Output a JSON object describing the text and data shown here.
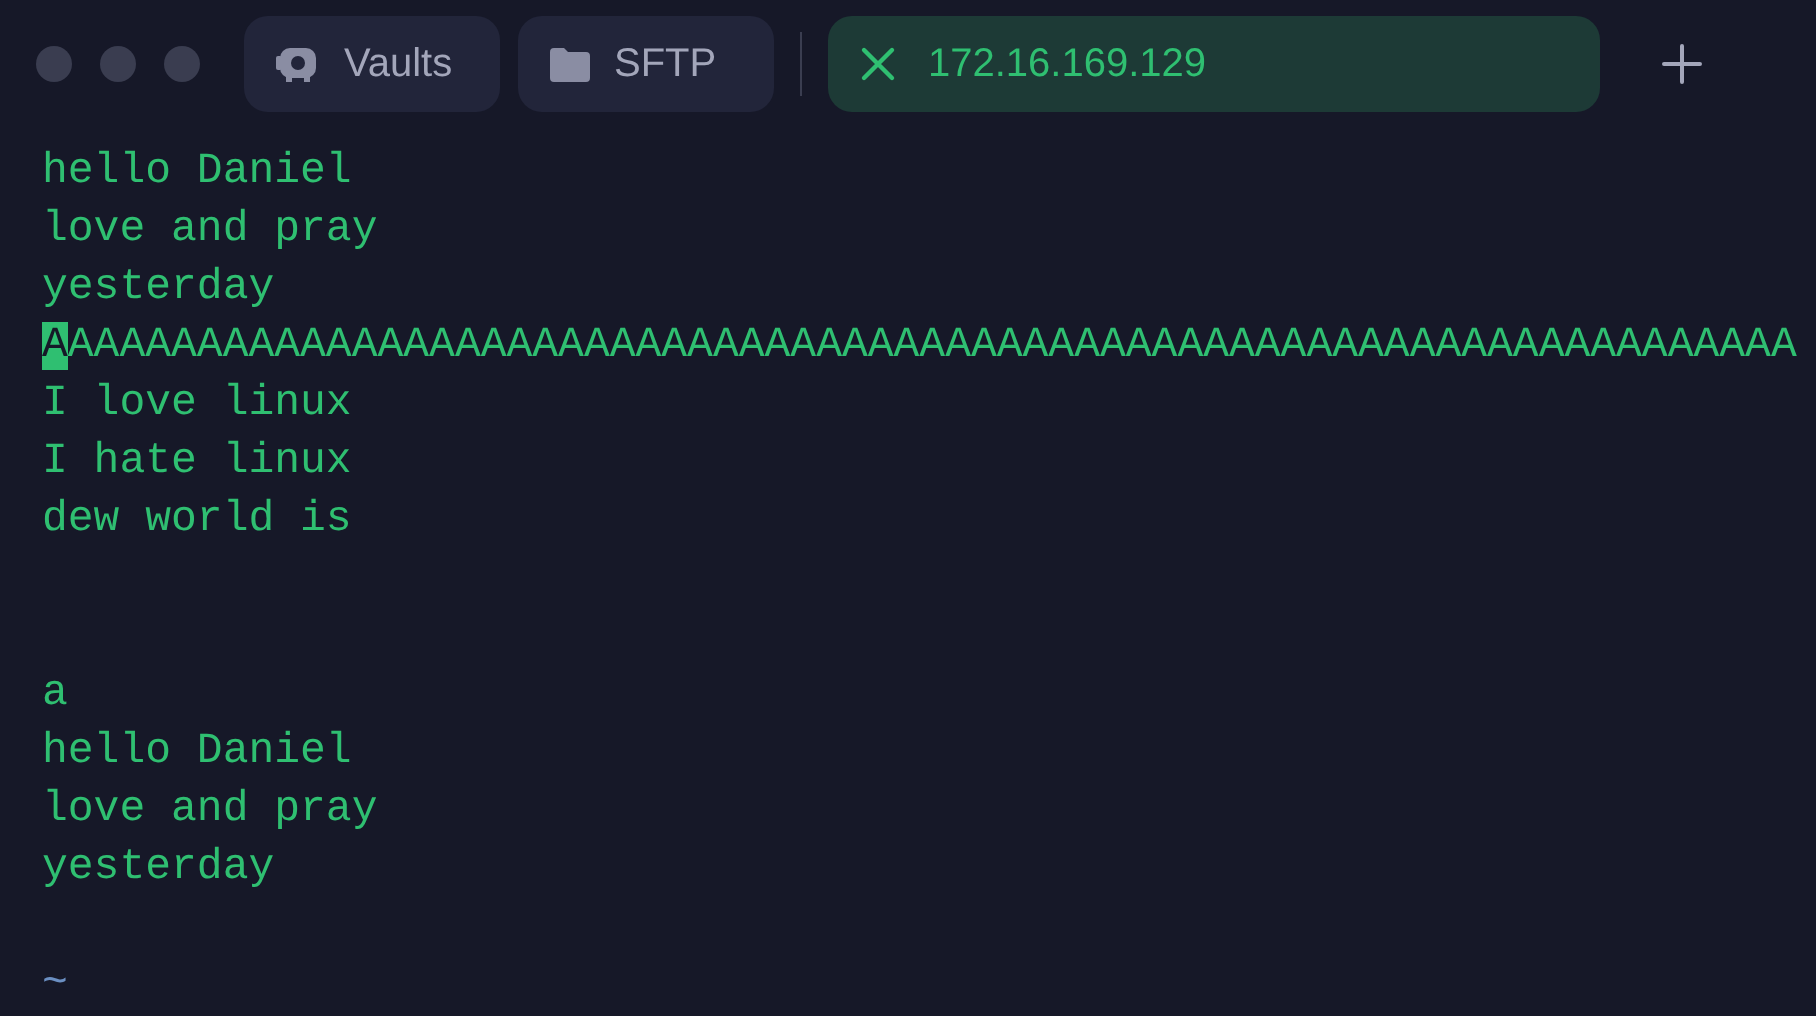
{
  "tabs": [
    {
      "kind": "vaults",
      "label": "Vaults",
      "selected": false
    },
    {
      "kind": "sftp",
      "label": "SFTP",
      "selected": false
    },
    {
      "kind": "host",
      "label": "172.16.169.129",
      "selected": true
    }
  ],
  "terminal": {
    "lines": [
      {
        "kind": "text",
        "text": "hello Daniel"
      },
      {
        "kind": "text",
        "text": "love and pray"
      },
      {
        "kind": "text",
        "text": "yesterday"
      },
      {
        "kind": "cursor",
        "text": "AAAAAAAAAAAAAAAAAAAAAAAAAAAAAAAAAAAAAAAAAAAAAAAAAAAAAAAAAAAAAAAAAAAA"
      },
      {
        "kind": "text",
        "text": "I love linux"
      },
      {
        "kind": "text",
        "text": "I hate linux"
      },
      {
        "kind": "text",
        "text": "dew world is"
      },
      {
        "kind": "blank"
      },
      {
        "kind": "blank"
      },
      {
        "kind": "text",
        "text": "a"
      },
      {
        "kind": "text",
        "text": "hello Daniel"
      },
      {
        "kind": "text",
        "text": "love and pray"
      },
      {
        "kind": "text",
        "text": "yesterday"
      },
      {
        "kind": "blank"
      },
      {
        "kind": "tilde",
        "text": "~"
      }
    ]
  }
}
